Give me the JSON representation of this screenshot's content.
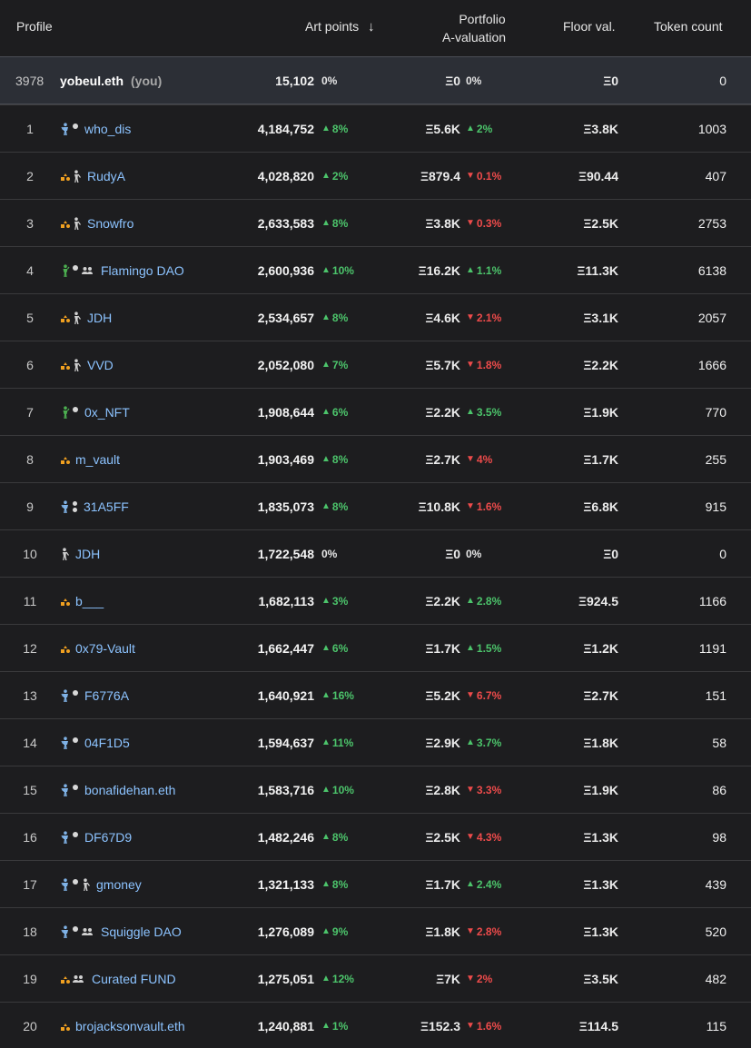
{
  "header": {
    "profile": "Profile",
    "art_points": "Art points",
    "portfolio_line1": "Portfolio",
    "portfolio_line2": "A-valuation",
    "floor": "Floor val.",
    "token_count": "Token count"
  },
  "colors": {
    "up": "#4cc46b",
    "down": "#ee4b4b",
    "link": "#8cc3ff",
    "you_row": "#2c2f36"
  },
  "you": {
    "rank": "3978",
    "name": "yobeul.eth",
    "tag": "(you)",
    "points": "15,102",
    "points_change": "0%",
    "portfolio": "Ξ0",
    "portfolio_change": "0%",
    "floor": "Ξ0",
    "tokens": "0"
  },
  "rows": [
    {
      "rank": "1",
      "icons": [
        "person-blue",
        "dot"
      ],
      "name": "who_dis",
      "points": "4,184,752",
      "pts_dir": "up",
      "pts_ch": "8%",
      "portfolio": "Ξ5.6K",
      "port_dir": "up",
      "port_ch": "2%",
      "floor": "Ξ3.8K",
      "tokens": "1003"
    },
    {
      "rank": "2",
      "icons": [
        "orange-shapes",
        "person-white"
      ],
      "name": "RudyA",
      "points": "4,028,820",
      "pts_dir": "up",
      "pts_ch": "2%",
      "portfolio": "Ξ879.4",
      "port_dir": "down",
      "port_ch": "0.1%",
      "floor": "Ξ90.44",
      "tokens": "407"
    },
    {
      "rank": "3",
      "icons": [
        "orange-shapes",
        "person-white"
      ],
      "name": "Snowfro",
      "points": "2,633,583",
      "pts_dir": "up",
      "pts_ch": "8%",
      "portfolio": "Ξ3.8K",
      "port_dir": "down",
      "port_ch": "0.3%",
      "floor": "Ξ2.5K",
      "tokens": "2753"
    },
    {
      "rank": "4",
      "icons": [
        "person-green",
        "dot",
        "group"
      ],
      "name": "Flamingo DAO",
      "points": "2,600,936",
      "pts_dir": "up",
      "pts_ch": "10%",
      "portfolio": "Ξ16.2K",
      "port_dir": "up",
      "port_ch": "1.1%",
      "floor": "Ξ11.3K",
      "tokens": "6138"
    },
    {
      "rank": "5",
      "icons": [
        "orange-shapes",
        "person-white"
      ],
      "name": "JDH",
      "points": "2,534,657",
      "pts_dir": "up",
      "pts_ch": "8%",
      "portfolio": "Ξ4.6K",
      "port_dir": "down",
      "port_ch": "2.1%",
      "floor": "Ξ3.1K",
      "tokens": "2057"
    },
    {
      "rank": "6",
      "icons": [
        "orange-shapes",
        "person-white"
      ],
      "name": "VVD",
      "points": "2,052,080",
      "pts_dir": "up",
      "pts_ch": "7%",
      "portfolio": "Ξ5.7K",
      "port_dir": "down",
      "port_ch": "1.8%",
      "floor": "Ξ2.2K",
      "tokens": "1666"
    },
    {
      "rank": "7",
      "icons": [
        "person-green",
        "dot"
      ],
      "name": "0x_NFT",
      "points": "1,908,644",
      "pts_dir": "up",
      "pts_ch": "6%",
      "portfolio": "Ξ2.2K",
      "port_dir": "up",
      "port_ch": "3.5%",
      "floor": "Ξ1.9K",
      "tokens": "770"
    },
    {
      "rank": "8",
      "icons": [
        "orange-shapes"
      ],
      "name": "m_vault",
      "points": "1,903,469",
      "pts_dir": "up",
      "pts_ch": "8%",
      "portfolio": "Ξ2.7K",
      "port_dir": "down",
      "port_ch": "4%",
      "floor": "Ξ1.7K",
      "tokens": "255"
    },
    {
      "rank": "9",
      "icons": [
        "person-blue",
        "dot2"
      ],
      "name": "31A5FF",
      "points": "1,835,073",
      "pts_dir": "up",
      "pts_ch": "8%",
      "portfolio": "Ξ10.8K",
      "port_dir": "down",
      "port_ch": "1.6%",
      "floor": "Ξ6.8K",
      "tokens": "915"
    },
    {
      "rank": "10",
      "icons": [
        "person-white"
      ],
      "name": "JDH",
      "points": "1,722,548",
      "pts_dir": "flat",
      "pts_ch": "0%",
      "portfolio": "Ξ0",
      "port_dir": "flat",
      "port_ch": "0%",
      "floor": "Ξ0",
      "tokens": "0"
    },
    {
      "rank": "11",
      "icons": [
        "orange-shapes"
      ],
      "name": "b___",
      "points": "1,682,113",
      "pts_dir": "up",
      "pts_ch": "3%",
      "portfolio": "Ξ2.2K",
      "port_dir": "up",
      "port_ch": "2.8%",
      "floor": "Ξ924.5",
      "tokens": "1166"
    },
    {
      "rank": "12",
      "icons": [
        "orange-shapes"
      ],
      "name": "0x79-Vault",
      "points": "1,662,447",
      "pts_dir": "up",
      "pts_ch": "6%",
      "portfolio": "Ξ1.7K",
      "port_dir": "up",
      "port_ch": "1.5%",
      "floor": "Ξ1.2K",
      "tokens": "1191"
    },
    {
      "rank": "13",
      "icons": [
        "person-blue",
        "dot"
      ],
      "name": "F6776A",
      "points": "1,640,921",
      "pts_dir": "up",
      "pts_ch": "16%",
      "portfolio": "Ξ5.2K",
      "port_dir": "down",
      "port_ch": "6.7%",
      "floor": "Ξ2.7K",
      "tokens": "151"
    },
    {
      "rank": "14",
      "icons": [
        "person-blue",
        "dot"
      ],
      "name": "04F1D5",
      "points": "1,594,637",
      "pts_dir": "up",
      "pts_ch": "11%",
      "portfolio": "Ξ2.9K",
      "port_dir": "up",
      "port_ch": "3.7%",
      "floor": "Ξ1.8K",
      "tokens": "58"
    },
    {
      "rank": "15",
      "icons": [
        "person-blue",
        "dot"
      ],
      "name": "bonafidehan.eth",
      "points": "1,583,716",
      "pts_dir": "up",
      "pts_ch": "10%",
      "portfolio": "Ξ2.8K",
      "port_dir": "down",
      "port_ch": "3.3%",
      "floor": "Ξ1.9K",
      "tokens": "86"
    },
    {
      "rank": "16",
      "icons": [
        "person-blue",
        "dot"
      ],
      "name": "DF67D9",
      "points": "1,482,246",
      "pts_dir": "up",
      "pts_ch": "8%",
      "portfolio": "Ξ2.5K",
      "port_dir": "down",
      "port_ch": "4.3%",
      "floor": "Ξ1.3K",
      "tokens": "98"
    },
    {
      "rank": "17",
      "icons": [
        "person-blue",
        "dot",
        "person-white"
      ],
      "name": "gmoney",
      "points": "1,321,133",
      "pts_dir": "up",
      "pts_ch": "8%",
      "portfolio": "Ξ1.7K",
      "port_dir": "up",
      "port_ch": "2.4%",
      "floor": "Ξ1.3K",
      "tokens": "439"
    },
    {
      "rank": "18",
      "icons": [
        "person-blue",
        "dot",
        "group"
      ],
      "name": "Squiggle DAO",
      "points": "1,276,089",
      "pts_dir": "up",
      "pts_ch": "9%",
      "portfolio": "Ξ1.8K",
      "port_dir": "down",
      "port_ch": "2.8%",
      "floor": "Ξ1.3K",
      "tokens": "520"
    },
    {
      "rank": "19",
      "icons": [
        "orange-shapes",
        "group"
      ],
      "name": "Curated FUND",
      "points": "1,275,051",
      "pts_dir": "up",
      "pts_ch": "12%",
      "portfolio": "Ξ7K",
      "port_dir": "down",
      "port_ch": "2%",
      "floor": "Ξ3.5K",
      "tokens": "482"
    },
    {
      "rank": "20",
      "icons": [
        "orange-shapes"
      ],
      "name": "brojacksonvault.eth",
      "points": "1,240,881",
      "pts_dir": "up",
      "pts_ch": "1%",
      "portfolio": "Ξ152.3",
      "port_dir": "down",
      "port_ch": "1.6%",
      "floor": "Ξ114.5",
      "tokens": "115"
    }
  ]
}
